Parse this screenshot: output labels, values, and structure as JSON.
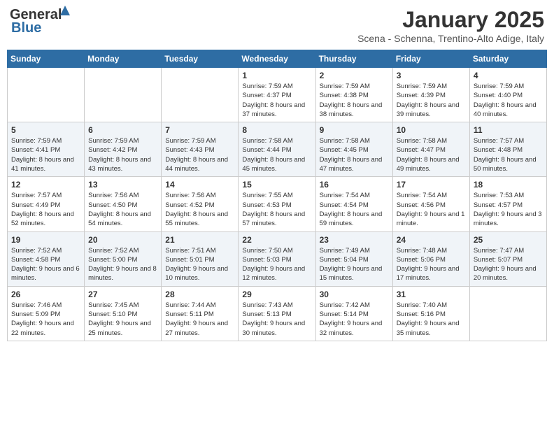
{
  "header": {
    "logo_general": "General",
    "logo_blue": "Blue",
    "month": "January 2025",
    "location": "Scena - Schenna, Trentino-Alto Adige, Italy"
  },
  "days_of_week": [
    "Sunday",
    "Monday",
    "Tuesday",
    "Wednesday",
    "Thursday",
    "Friday",
    "Saturday"
  ],
  "weeks": [
    [
      {
        "day": "",
        "info": ""
      },
      {
        "day": "",
        "info": ""
      },
      {
        "day": "",
        "info": ""
      },
      {
        "day": "1",
        "info": "Sunrise: 7:59 AM\nSunset: 4:37 PM\nDaylight: 8 hours and 37 minutes."
      },
      {
        "day": "2",
        "info": "Sunrise: 7:59 AM\nSunset: 4:38 PM\nDaylight: 8 hours and 38 minutes."
      },
      {
        "day": "3",
        "info": "Sunrise: 7:59 AM\nSunset: 4:39 PM\nDaylight: 8 hours and 39 minutes."
      },
      {
        "day": "4",
        "info": "Sunrise: 7:59 AM\nSunset: 4:40 PM\nDaylight: 8 hours and 40 minutes."
      }
    ],
    [
      {
        "day": "5",
        "info": "Sunrise: 7:59 AM\nSunset: 4:41 PM\nDaylight: 8 hours and 41 minutes."
      },
      {
        "day": "6",
        "info": "Sunrise: 7:59 AM\nSunset: 4:42 PM\nDaylight: 8 hours and 43 minutes."
      },
      {
        "day": "7",
        "info": "Sunrise: 7:59 AM\nSunset: 4:43 PM\nDaylight: 8 hours and 44 minutes."
      },
      {
        "day": "8",
        "info": "Sunrise: 7:58 AM\nSunset: 4:44 PM\nDaylight: 8 hours and 45 minutes."
      },
      {
        "day": "9",
        "info": "Sunrise: 7:58 AM\nSunset: 4:45 PM\nDaylight: 8 hours and 47 minutes."
      },
      {
        "day": "10",
        "info": "Sunrise: 7:58 AM\nSunset: 4:47 PM\nDaylight: 8 hours and 49 minutes."
      },
      {
        "day": "11",
        "info": "Sunrise: 7:57 AM\nSunset: 4:48 PM\nDaylight: 8 hours and 50 minutes."
      }
    ],
    [
      {
        "day": "12",
        "info": "Sunrise: 7:57 AM\nSunset: 4:49 PM\nDaylight: 8 hours and 52 minutes."
      },
      {
        "day": "13",
        "info": "Sunrise: 7:56 AM\nSunset: 4:50 PM\nDaylight: 8 hours and 54 minutes."
      },
      {
        "day": "14",
        "info": "Sunrise: 7:56 AM\nSunset: 4:52 PM\nDaylight: 8 hours and 55 minutes."
      },
      {
        "day": "15",
        "info": "Sunrise: 7:55 AM\nSunset: 4:53 PM\nDaylight: 8 hours and 57 minutes."
      },
      {
        "day": "16",
        "info": "Sunrise: 7:54 AM\nSunset: 4:54 PM\nDaylight: 8 hours and 59 minutes."
      },
      {
        "day": "17",
        "info": "Sunrise: 7:54 AM\nSunset: 4:56 PM\nDaylight: 9 hours and 1 minute."
      },
      {
        "day": "18",
        "info": "Sunrise: 7:53 AM\nSunset: 4:57 PM\nDaylight: 9 hours and 3 minutes."
      }
    ],
    [
      {
        "day": "19",
        "info": "Sunrise: 7:52 AM\nSunset: 4:58 PM\nDaylight: 9 hours and 6 minutes."
      },
      {
        "day": "20",
        "info": "Sunrise: 7:52 AM\nSunset: 5:00 PM\nDaylight: 9 hours and 8 minutes."
      },
      {
        "day": "21",
        "info": "Sunrise: 7:51 AM\nSunset: 5:01 PM\nDaylight: 9 hours and 10 minutes."
      },
      {
        "day": "22",
        "info": "Sunrise: 7:50 AM\nSunset: 5:03 PM\nDaylight: 9 hours and 12 minutes."
      },
      {
        "day": "23",
        "info": "Sunrise: 7:49 AM\nSunset: 5:04 PM\nDaylight: 9 hours and 15 minutes."
      },
      {
        "day": "24",
        "info": "Sunrise: 7:48 AM\nSunset: 5:06 PM\nDaylight: 9 hours and 17 minutes."
      },
      {
        "day": "25",
        "info": "Sunrise: 7:47 AM\nSunset: 5:07 PM\nDaylight: 9 hours and 20 minutes."
      }
    ],
    [
      {
        "day": "26",
        "info": "Sunrise: 7:46 AM\nSunset: 5:09 PM\nDaylight: 9 hours and 22 minutes."
      },
      {
        "day": "27",
        "info": "Sunrise: 7:45 AM\nSunset: 5:10 PM\nDaylight: 9 hours and 25 minutes."
      },
      {
        "day": "28",
        "info": "Sunrise: 7:44 AM\nSunset: 5:11 PM\nDaylight: 9 hours and 27 minutes."
      },
      {
        "day": "29",
        "info": "Sunrise: 7:43 AM\nSunset: 5:13 PM\nDaylight: 9 hours and 30 minutes."
      },
      {
        "day": "30",
        "info": "Sunrise: 7:42 AM\nSunset: 5:14 PM\nDaylight: 9 hours and 32 minutes."
      },
      {
        "day": "31",
        "info": "Sunrise: 7:40 AM\nSunset: 5:16 PM\nDaylight: 9 hours and 35 minutes."
      },
      {
        "day": "",
        "info": ""
      }
    ]
  ]
}
